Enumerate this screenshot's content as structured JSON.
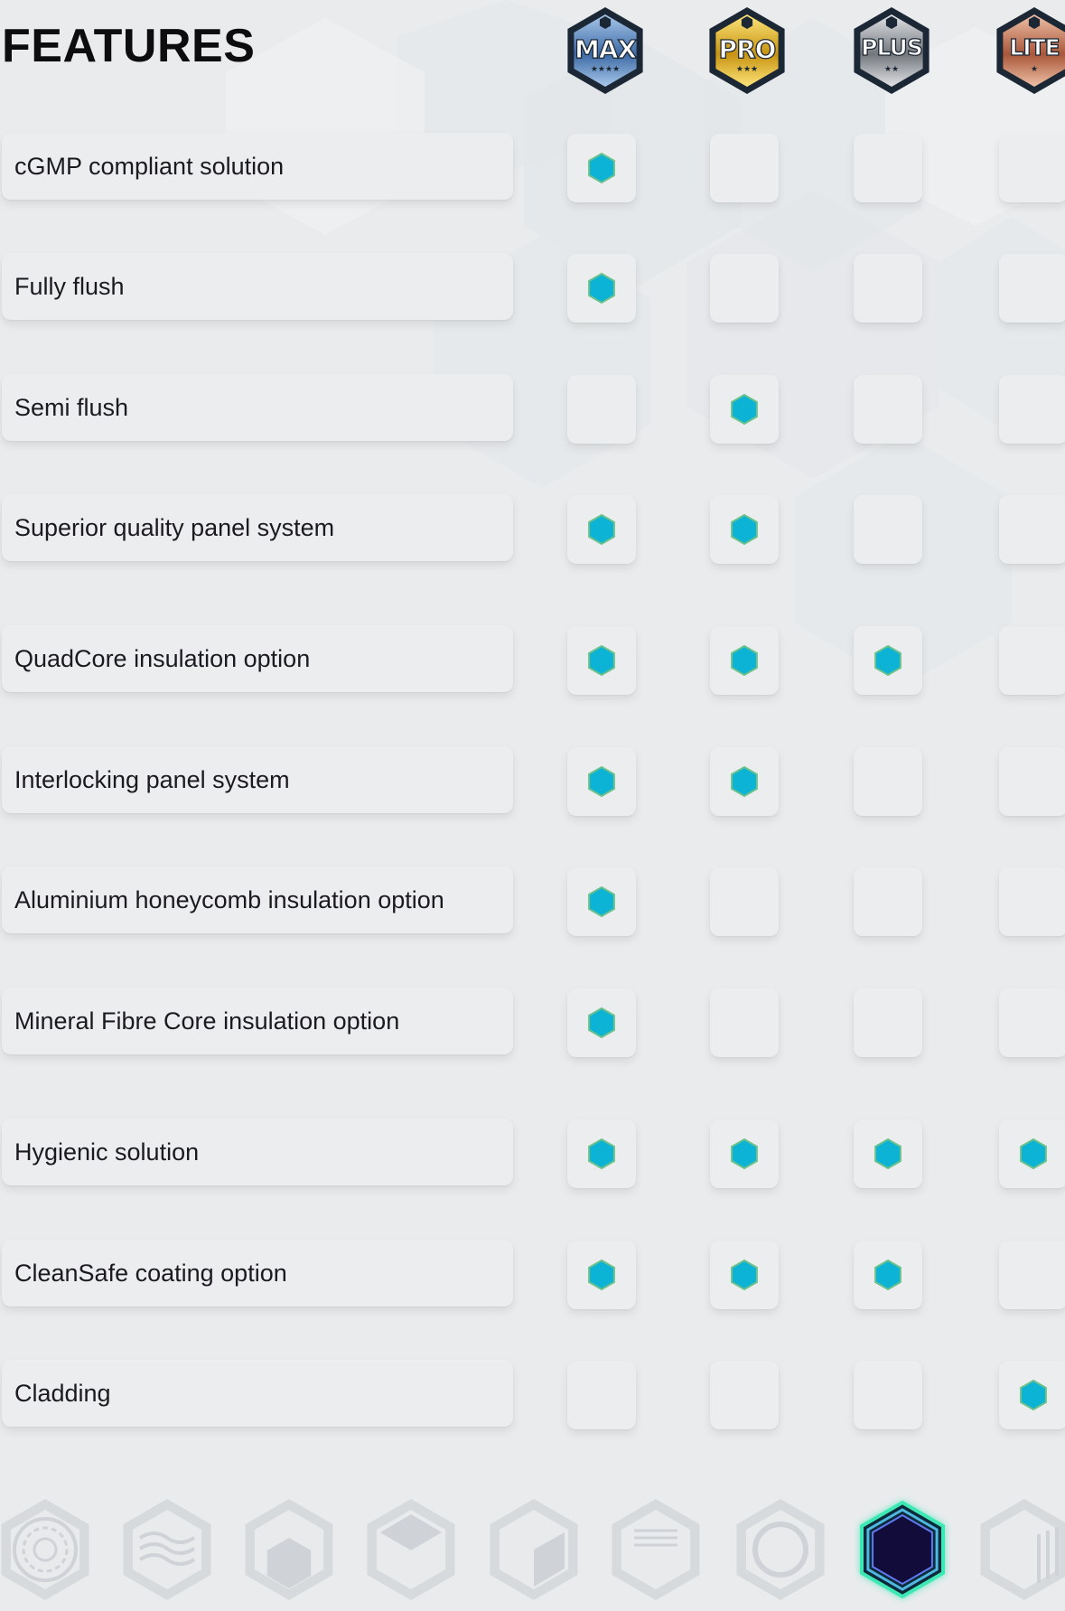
{
  "header": {
    "title": "FEATURES",
    "tiers": [
      {
        "label": "MAX",
        "stars": "★★★★",
        "colors": [
          "#3c6aa4",
          "#a9c8ec"
        ]
      },
      {
        "label": "PRO",
        "stars": "★★★",
        "colors": [
          "#c79311",
          "#fde57a"
        ]
      },
      {
        "label": "PLUS",
        "stars": "★★",
        "colors": [
          "#73777c",
          "#e1e3e6"
        ]
      },
      {
        "label": "LITE",
        "stars": "★",
        "colors": [
          "#a9573a",
          "#eec0a6"
        ]
      }
    ]
  },
  "features": [
    {
      "label": "cGMP compliant solution",
      "checks": [
        true,
        false,
        false,
        false
      ]
    },
    {
      "label": "Fully flush",
      "checks": [
        true,
        false,
        false,
        false
      ]
    },
    {
      "label": "Semi flush",
      "checks": [
        false,
        true,
        false,
        false
      ]
    },
    {
      "label": "Superior quality panel system",
      "checks": [
        true,
        true,
        false,
        false
      ]
    },
    {
      "label": "QuadCore insulation option",
      "checks": [
        true,
        true,
        true,
        false
      ]
    },
    {
      "label": "Interlocking panel system",
      "checks": [
        true,
        true,
        false,
        false
      ]
    },
    {
      "label": "Aluminium honeycomb insulation option",
      "checks": [
        true,
        false,
        false,
        false
      ]
    },
    {
      "label": "Mineral Fibre Core insulation option",
      "checks": [
        true,
        false,
        false,
        false
      ]
    },
    {
      "label": "Hygienic solution",
      "checks": [
        true,
        true,
        true,
        true
      ]
    },
    {
      "label": "CleanSafe coating option",
      "checks": [
        true,
        true,
        true,
        false
      ]
    },
    {
      "label": "Cladding",
      "checks": [
        false,
        false,
        false,
        true
      ]
    }
  ],
  "theme": {
    "background": "#e9ebed",
    "check_fill": "#0cb3d4",
    "check_stroke": "#6cc18c",
    "active_nav": "#3ee8b4"
  },
  "bottom_nav": [
    {
      "name": "swirl-pattern-icon",
      "active": false
    },
    {
      "name": "wave-layers-icon",
      "active": false
    },
    {
      "name": "layered-panel-icon",
      "active": false
    },
    {
      "name": "cube-top-icon",
      "active": false
    },
    {
      "name": "cube-side-icon",
      "active": false
    },
    {
      "name": "striped-cube-icon",
      "active": false
    },
    {
      "name": "ring-icon",
      "active": false
    },
    {
      "name": "active-hexagon-icon",
      "active": true
    },
    {
      "name": "ribbed-cube-icon",
      "active": false
    }
  ]
}
